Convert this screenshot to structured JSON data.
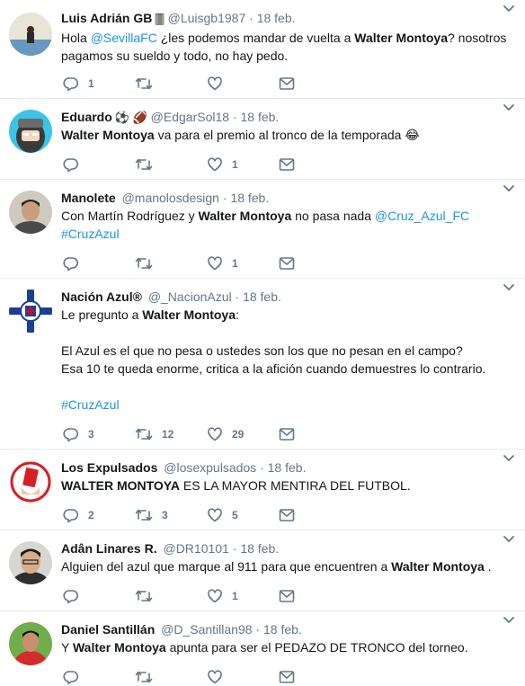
{
  "tweets": [
    {
      "name": "Luis Adrián GB",
      "name_emoji": "🀫",
      "handle": "@Luisgb1987",
      "time": "18 feb.",
      "lines": [
        [
          "Hola ",
          {
            "link": "@SevillaFC"
          },
          " ¿les podemos mandar de vuelta a ",
          {
            "bold": "Walter Montoya"
          },
          "? nosotros"
        ],
        [
          "pagamos su sueldo y todo, no hay pedo."
        ]
      ],
      "reply_count": "1",
      "retweet_count": "",
      "like_count": ""
    },
    {
      "name": "Eduardo",
      "name_emoji": "⚽ 🏈",
      "handle": "@EdgarSol18",
      "time": "18 feb.",
      "lines": [
        [
          {
            "bold": "Walter Montoya"
          },
          " va para el premio al tronco de la temporada 😂"
        ]
      ],
      "reply_count": "",
      "retweet_count": "",
      "like_count": "1"
    },
    {
      "name": "Manolete",
      "name_emoji": "",
      "handle": "@manolosdesign",
      "time": "18 feb.",
      "lines": [
        [
          "Con Martín Rodríguez y ",
          {
            "bold": "Walter Montoya"
          },
          " no pasa nada ",
          {
            "link": "@Cruz_Azul_FC"
          }
        ],
        [
          {
            "link": "#CruzAzul"
          }
        ]
      ],
      "reply_count": "",
      "retweet_count": "",
      "like_count": "1"
    },
    {
      "name": "Nación Azul®",
      "name_emoji": "",
      "handle": "@_NacionAzul",
      "time": "18 feb.",
      "lines": [
        [
          "Le pregunto a ",
          {
            "bold": "Walter Montoya"
          },
          ":"
        ],
        [
          ""
        ],
        [
          "El Azul es el que no pesa o ustedes son los que no pesan en el campo?"
        ],
        [
          "Esa 10 te queda enorme, critica a la afición cuando demuestres lo contrario."
        ],
        [
          ""
        ],
        [
          {
            "link": "#CruzAzul"
          }
        ]
      ],
      "reply_count": "3",
      "retweet_count": "12",
      "like_count": "29"
    },
    {
      "name": "Los Expulsados",
      "name_emoji": "",
      "handle": "@losexpulsados",
      "time": "18 feb.",
      "lines": [
        [
          {
            "bold": "WALTER MONTOYA"
          },
          " ES LA MAYOR MENTIRA DEL FUTBOL."
        ]
      ],
      "reply_count": "2",
      "retweet_count": "3",
      "like_count": "5"
    },
    {
      "name": "Adân Linares R.",
      "name_emoji": "",
      "handle": "@DR10101",
      "time": "18 feb.",
      "lines": [
        [
          "Alguien del azul que marque al 911 para que encuentren a ",
          {
            "bold": "Walter Montoya"
          },
          " ."
        ]
      ],
      "reply_count": "",
      "retweet_count": "",
      "like_count": "1"
    },
    {
      "name": "Daniel Santillán",
      "name_emoji": "",
      "handle": "@D_Santillan98",
      "time": "18 feb.",
      "lines": [
        [
          "Y ",
          {
            "bold": "Walter Montoya"
          },
          " apunta para ser el PEDAZO DE TRONCO del torneo."
        ]
      ],
      "reply_count": "",
      "retweet_count": "",
      "like_count": ""
    }
  ],
  "colors": {
    "link": "#1b95e0",
    "muted": "#657786",
    "divider": "#e6ecf0"
  },
  "icons": [
    "reply-icon",
    "retweet-icon",
    "like-icon",
    "direct-message-icon",
    "caret-down-icon"
  ]
}
